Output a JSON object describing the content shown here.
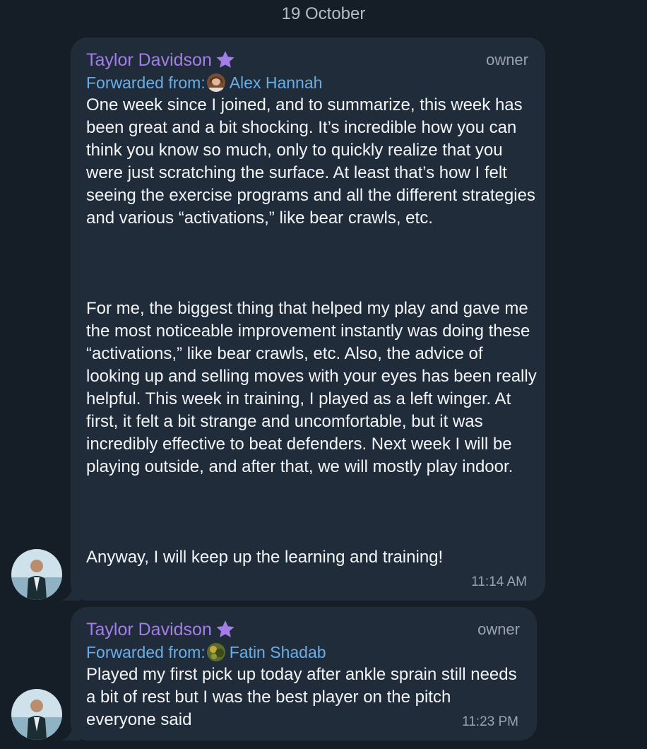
{
  "date_separator": "19 October",
  "colors": {
    "background": "#151d27",
    "bubble": "#202c3a",
    "sender": "#a37de8",
    "forward": "#6aaee8",
    "meta": "#9aa3ae"
  },
  "messages": [
    {
      "sender": "Taylor Davidson",
      "sender_icon": "star-icon",
      "role": "owner",
      "forwarded_prefix": "Forwarded from:",
      "forwarded_name": "Alex Hannah",
      "paragraphs": [
        "One week since I joined, and to summarize, this week has been great and a bit shocking. It’s incredible how you can think you know so much, only to quickly realize that you were just scratching the surface. At least that’s how I felt seeing the exercise programs and all the different strategies and various “activations,” like bear crawls, etc.",
        "For me, the biggest thing that helped my play and gave me the most noticeable improvement instantly was doing these “activations,” like bear crawls, etc. Also, the advice of looking up and selling moves with your eyes has been really helpful. This week in training, I played as a left winger. At first, it felt a bit strange and uncomfortable, but it was incredibly effective to beat defenders. Next week I will be playing outside, and after that, we will mostly play indoor.",
        "Anyway, I will keep up the learning and training!"
      ],
      "time": "11:14 AM"
    },
    {
      "sender": "Taylor Davidson",
      "sender_icon": "star-icon",
      "role": "owner",
      "forwarded_prefix": "Forwarded from:",
      "forwarded_name": "Fatin Shadab",
      "paragraphs": [
        "Played my first pick up today after ankle sprain still needs a bit of rest but I was the best player on the pitch everyone said"
      ],
      "time": "11:23 PM"
    }
  ]
}
